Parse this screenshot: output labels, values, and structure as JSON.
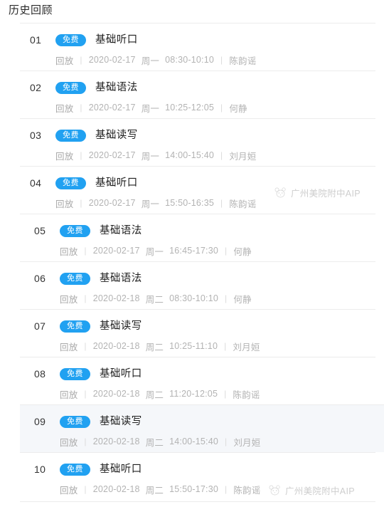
{
  "header": {
    "title": "历史回顾"
  },
  "theme": {
    "badge_bg": "#21a1f1",
    "badge_text": "#ffffff",
    "row_active_bg": "#f5f7fa",
    "divider": "#ececec",
    "meta_text": "#b3b3b3",
    "title_text": "#1f1f1f"
  },
  "labels": {
    "replay": "回放",
    "separator": "|",
    "free_badge": "免费"
  },
  "watermark": {
    "text": "广州美院附中AIP",
    "icon": "panda-icon"
  },
  "lessons": [
    {
      "index": "01",
      "badge": "免费",
      "title": "基础听口",
      "replay": "回放",
      "date": "2020-02-17",
      "weekday": "周一",
      "time": "08:30-10:10",
      "teacher": "陈韵谣",
      "active": false
    },
    {
      "index": "02",
      "badge": "免费",
      "title": "基础语法",
      "replay": "回放",
      "date": "2020-02-17",
      "weekday": "周一",
      "time": "10:25-12:05",
      "teacher": "何静",
      "active": false
    },
    {
      "index": "03",
      "badge": "免费",
      "title": "基础读写",
      "replay": "回放",
      "date": "2020-02-17",
      "weekday": "周一",
      "time": "14:00-15:40",
      "teacher": "刘月姮",
      "active": false
    },
    {
      "index": "04",
      "badge": "免费",
      "title": "基础听口",
      "replay": "回放",
      "date": "2020-02-17",
      "weekday": "周一",
      "time": "15:50-16:35",
      "teacher": "陈韵谣",
      "active": false
    },
    {
      "index": "05",
      "badge": "免费",
      "title": "基础语法",
      "replay": "回放",
      "date": "2020-02-17",
      "weekday": "周一",
      "time": "16:45-17:30",
      "teacher": "何静",
      "active": false
    },
    {
      "index": "06",
      "badge": "免费",
      "title": "基础语法",
      "replay": "回放",
      "date": "2020-02-18",
      "weekday": "周二",
      "time": "08:30-10:10",
      "teacher": "何静",
      "active": false
    },
    {
      "index": "07",
      "badge": "免费",
      "title": "基础读写",
      "replay": "回放",
      "date": "2020-02-18",
      "weekday": "周二",
      "time": "10:25-11:10",
      "teacher": "刘月姮",
      "active": false
    },
    {
      "index": "08",
      "badge": "免费",
      "title": "基础听口",
      "replay": "回放",
      "date": "2020-02-18",
      "weekday": "周二",
      "time": "11:20-12:05",
      "teacher": "陈韵谣",
      "active": false
    },
    {
      "index": "09",
      "badge": "免费",
      "title": "基础读写",
      "replay": "回放",
      "date": "2020-02-18",
      "weekday": "周二",
      "time": "14:00-15:40",
      "teacher": "刘月姮",
      "active": true
    },
    {
      "index": "10",
      "badge": "免费",
      "title": "基础听口",
      "replay": "回放",
      "date": "2020-02-18",
      "weekday": "周二",
      "time": "15:50-17:30",
      "teacher": "陈韵谣",
      "active": false
    }
  ]
}
